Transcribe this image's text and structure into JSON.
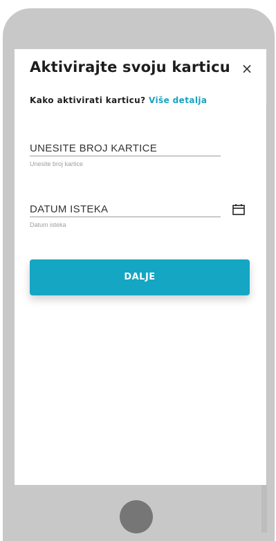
{
  "dialog": {
    "title": "Aktivirajte svoju karticu",
    "close_glyph": "×",
    "subtitle_prefix": "Kako aktivirati karticu?",
    "subtitle_link": "Više detalja"
  },
  "form": {
    "card_number": {
      "value": "UNESITE BROJ KARTICE",
      "helper": "Unesite broj kartice"
    },
    "expiry": {
      "value": "DATUM ISTEKA",
      "helper": "Datum isteka"
    },
    "submit_label": "DALJE"
  },
  "colors": {
    "accent": "#14a6c3",
    "link": "#17a2c0",
    "phone_frame": "#c8c8c8",
    "home_button": "#767676"
  },
  "icons": {
    "close": "close-icon",
    "calendar": "calendar-icon"
  }
}
